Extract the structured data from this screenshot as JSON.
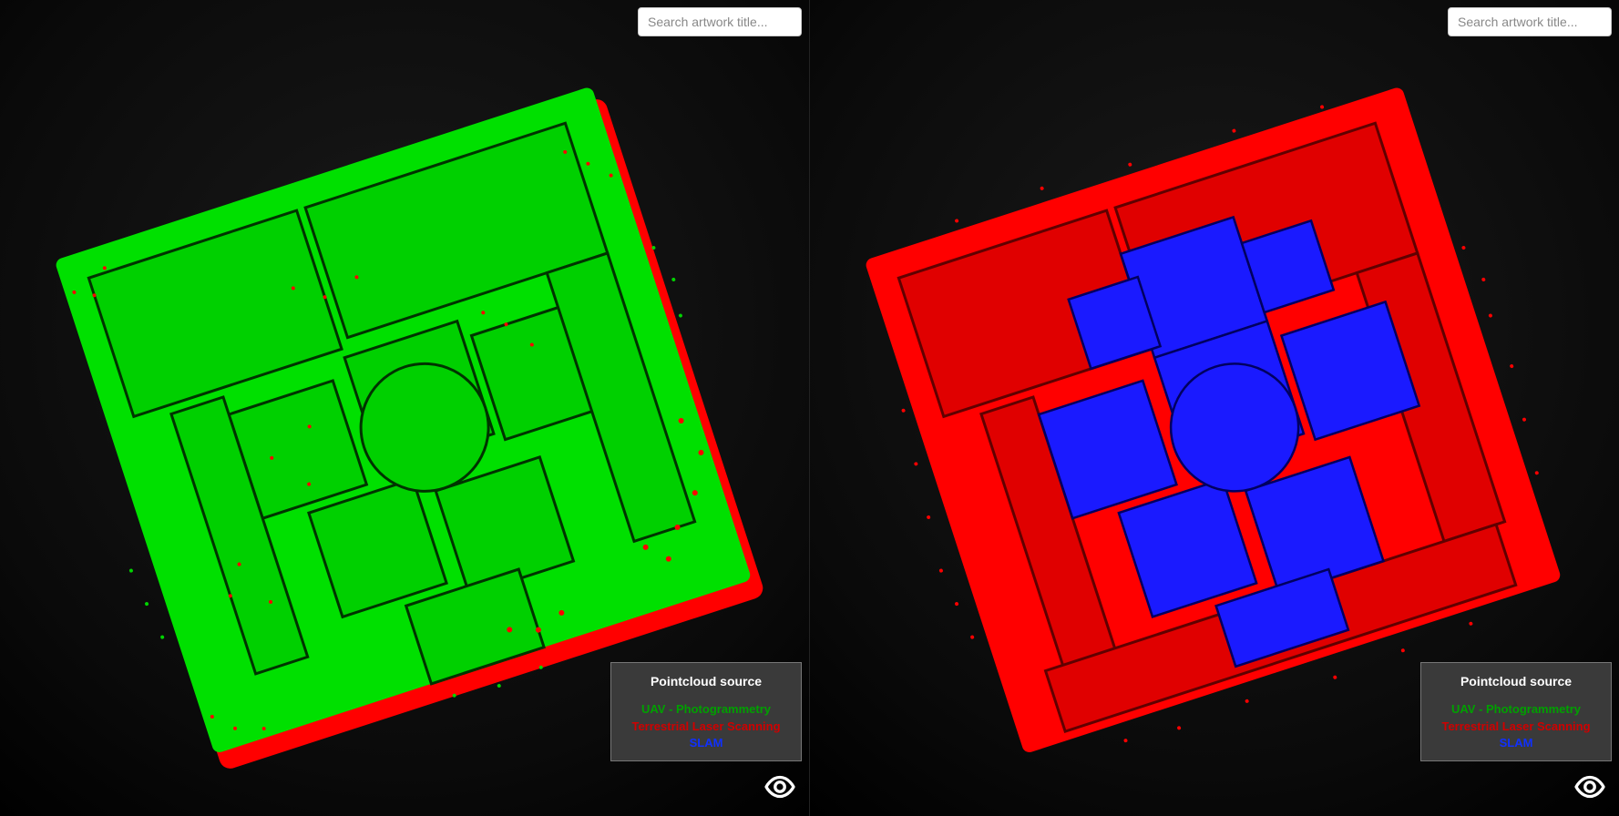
{
  "search": {
    "placeholder": "Search artwork title..."
  },
  "legend": {
    "title": "Pointcloud source",
    "items": [
      {
        "label": "UAV - Photogrammetry",
        "cls": "legend-uav"
      },
      {
        "label": "Terrestrial Laser Scanning",
        "cls": "legend-tls"
      },
      {
        "label": "SLAM",
        "cls": "legend-slam"
      }
    ]
  },
  "panels": {
    "left": {
      "dominant": "green",
      "secondary": "red"
    },
    "right": {
      "dominant": "red",
      "secondary": "blue"
    }
  }
}
